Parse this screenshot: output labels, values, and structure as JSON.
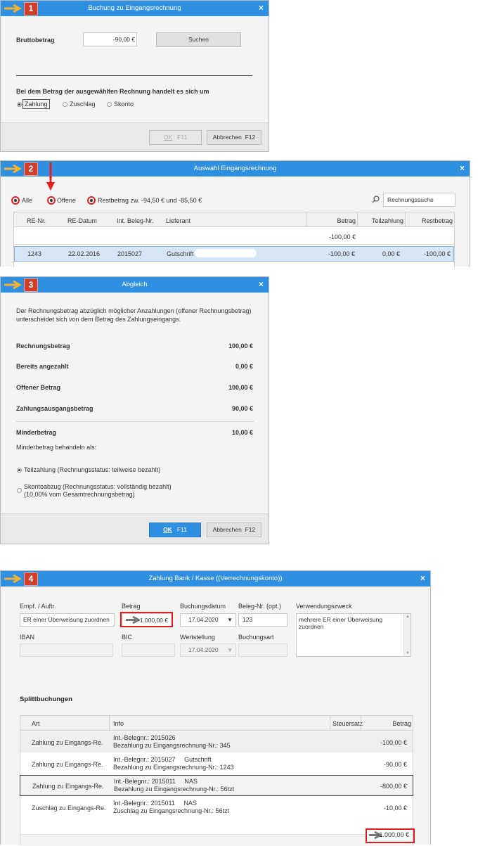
{
  "w1": {
    "step": "1",
    "title": "Buchung zu Eingangsrechnung",
    "close": "×",
    "brutto_label": "Bruttobetrag",
    "brutto_value": "-90,00 €",
    "search_btn": "Suchen",
    "question": "Bei dem Betrag der ausgewählten Rechnung handelt es sich um",
    "radios": [
      "Zahlung",
      "Zuschlag",
      "Skonto"
    ],
    "ok_label": "OK",
    "ok_key": "F11",
    "cancel_label": "Abbrechen",
    "cancel_key": "F12"
  },
  "w2": {
    "step": "2",
    "title": "Auswahl Eingangsrechnung",
    "close": "×",
    "filter_all": "Alle",
    "filter_open": "Offene",
    "filter_rest": "Restbetrag zw. -94,50 € und -85,50 €",
    "search_value": "Rechnungssuche",
    "columns": [
      "RE-Nr.",
      "RE-Datum",
      "Int. Beleg-Nr.",
      "Lieferant",
      "Betrag",
      "Teilzahlung",
      "Restbetrag"
    ],
    "sum_value": "-100,00 €",
    "row": {
      "re_nr": "1243",
      "re_datum": "22.02.2016",
      "beleg": "2015027",
      "lieferant": "Gutschrift",
      "betrag": "-100,00 €",
      "teilzahlung": "0,00 €",
      "rest": "-100,00 €"
    }
  },
  "w3": {
    "step": "3",
    "title": "Abgleich",
    "close": "×",
    "intro1": "Der Rechnungsbetrag abzüglich möglicher Anzahlungen (offener Rechnungsbetrag)",
    "intro2": "unterscheidet sich von dem Betrag des Zahlungseingangs.",
    "rows": [
      {
        "label": "Rechnungsbetrag",
        "value": "100,00 €"
      },
      {
        "label": "Bereits angezahlt",
        "value": "0,00 €"
      },
      {
        "label": "Offener Betrag",
        "value": "100,00 €"
      },
      {
        "label": "Zahlungsausgangsbetrag",
        "value": "90,00 €"
      }
    ],
    "minder_label": "Minderbetrag",
    "minder_value": "10,00 €",
    "treat_label": "Minderbetrag behandeln als:",
    "opt1": "Teilzahlung (Rechnungsstatus: teilweise bezahlt)",
    "opt2a": "Skontoabzug (Rechnungsstatus: vollständig bezahlt)",
    "opt2b": "(10,00% vom Gesamtrechnungsbetrag)",
    "ok_label": "OK",
    "ok_key": "F11",
    "cancel_label": "Abbrechen",
    "cancel_key": "F12"
  },
  "w4": {
    "step": "4",
    "title": "Zahlung Bank / Kasse ((Verrechnungskonto))",
    "close": "×",
    "empf_label": "Empf. / Auftr.",
    "empf_value": "ER einer Überweisung zuordnen",
    "betrag_label": "Betrag",
    "betrag_value": "-1.000,00 €",
    "datum_label": "Buchungsdatum",
    "datum_value": "17.04.2020",
    "beleg_label": "Beleg-Nr. (opt.)",
    "beleg_value": "123",
    "zweck_label": "Verwendungszweck",
    "zweck_line1": "mehrere ER einer Überweisung",
    "zweck_line2": "zuordnen",
    "iban_label": "IBAN",
    "bic_label": "BIC",
    "wert_label": "Wertstellung",
    "wert_value": "17.04.2020",
    "art_label": "Buchungsart",
    "split_title": "Splittbuchungen",
    "columns": [
      "Art",
      "Info",
      "Steuersatz",
      "Betrag"
    ],
    "rows": [
      {
        "art": "Zahlung zu Eingangs-Re.",
        "info1": "Int.-Belegnr.: 2015026",
        "info2": "Bezahlung zu Eingangsrechnung-Nr.: 345",
        "betrag": "-100,00 €"
      },
      {
        "art": "Zahlung zu Eingangs-Re.",
        "info1": "Int.-Belegnr.: 2015027     Gutschrift",
        "info2": "Bezahlung zu Eingangsrechnung-Nr.: 1243",
        "betrag": "-90,00 €"
      },
      {
        "art": "Zahlung zu Eingangs-Re.",
        "info1": "Int.-Belegnr.: 2015011     NAS",
        "info2": "Bezahlung zu Eingangsrechnung-Nr.: 56tzt",
        "betrag": "-800,00 €"
      },
      {
        "art": "Zuschlag zu Eingangs-Re.",
        "info1": "Int.-Belegnr.: 2015011     NAS",
        "info2": "Zuschlag zu Eingangsrechnung-Nr.: 56tzt",
        "betrag": "-10,00 €"
      }
    ],
    "total": "-1.000,00 €"
  }
}
